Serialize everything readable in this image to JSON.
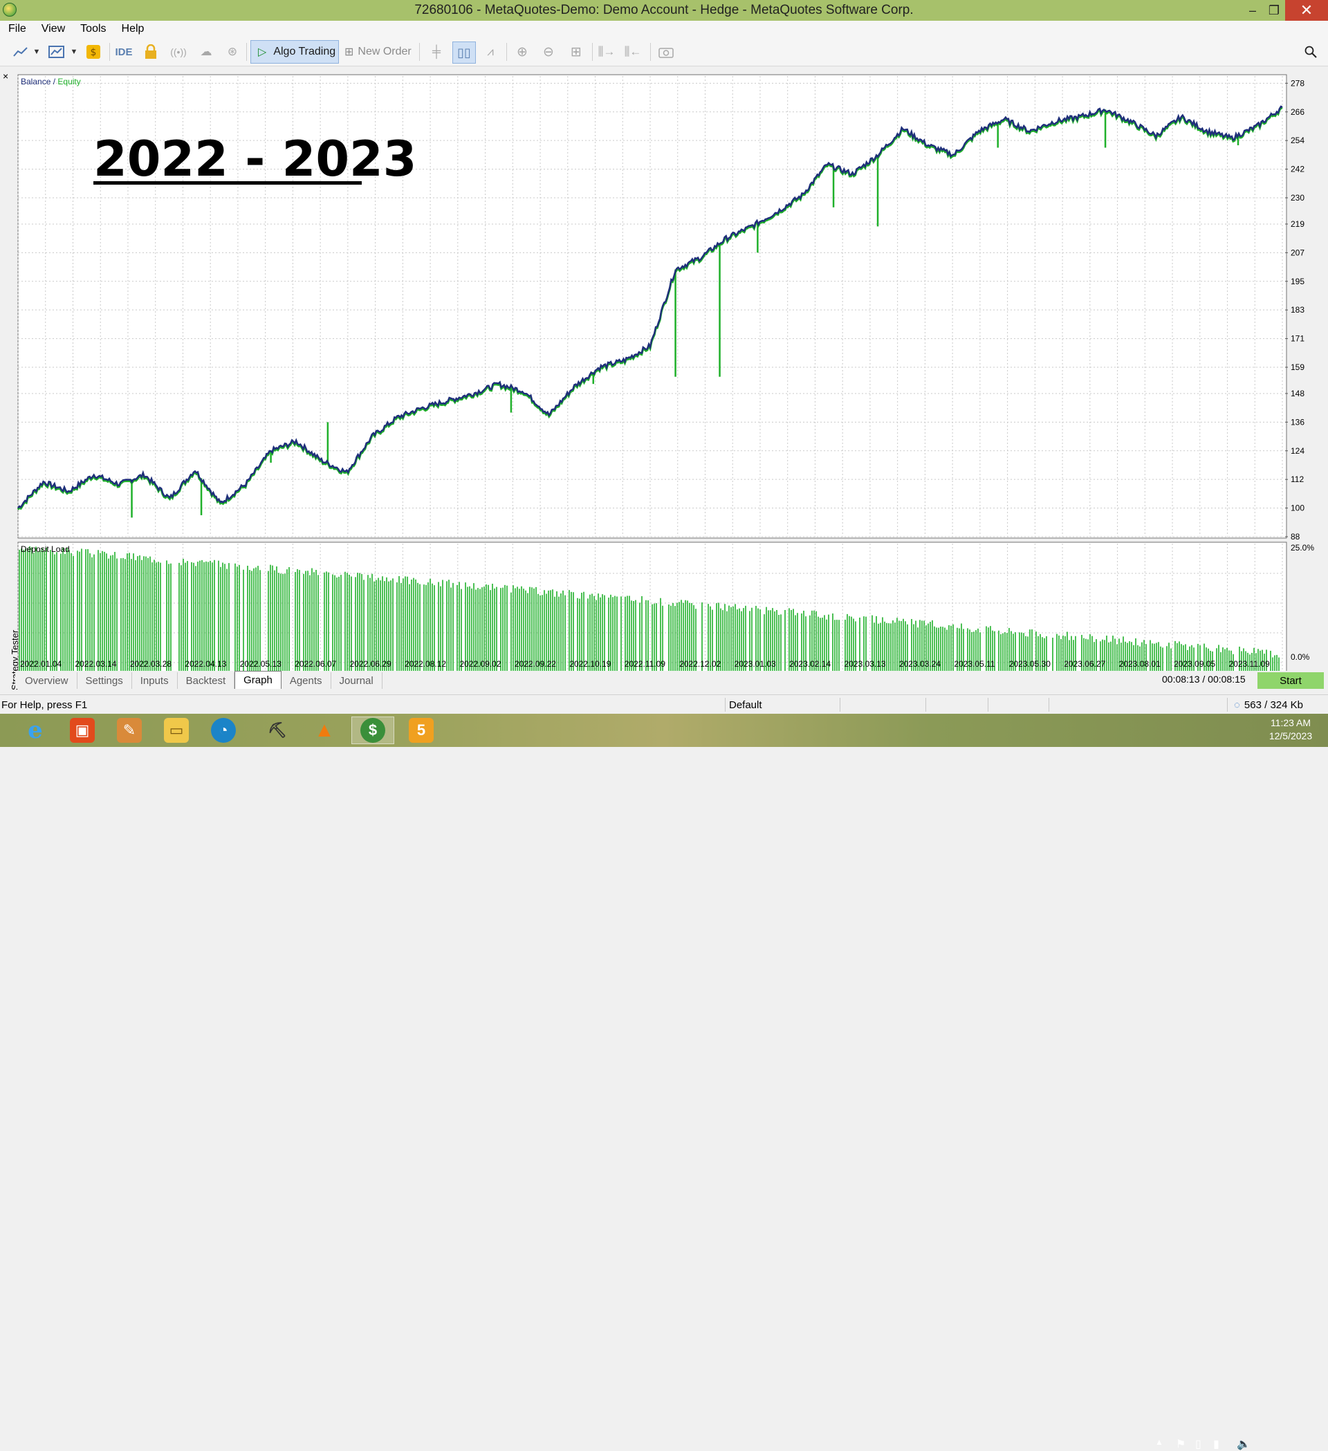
{
  "window": {
    "title": "72680106 - MetaQuotes-Demo: Demo Account - Hedge - MetaQuotes Software Corp.",
    "controls": {
      "minimize": "–",
      "maximize": "❐",
      "close": "✕"
    }
  },
  "menu": [
    "File",
    "View",
    "Tools",
    "Help"
  ],
  "toolbar": {
    "ide_label": "IDE",
    "algo_trading_label": "Algo Trading",
    "new_order_label": "New Order"
  },
  "chart": {
    "legend_balance": "Balance",
    "legend_separator": " / ",
    "legend_equity": "Equity",
    "overlay_title": "2022 - 2023",
    "subchart_label": "Deposit Load",
    "sub_y_top": "25.0%",
    "sub_y_bottom": "0.0%",
    "colors": {
      "balance": "#1f2f7a",
      "equity": "#1fb02a",
      "load": "#1fb02a",
      "grid": "#c9c9c9",
      "overlay": "#000000"
    }
  },
  "chart_data": {
    "type": "line",
    "y_ticks": [
      "278",
      "266",
      "254",
      "242",
      "230",
      "219",
      "207",
      "195",
      "183",
      "171",
      "159",
      "148",
      "136",
      "124",
      "112",
      "100",
      "88"
    ],
    "x_ticks": [
      "2022.01.04",
      "2022.03.14",
      "2022.03.28",
      "2022.04.13",
      "2022.05.13",
      "2022.06.07",
      "2022.06.29",
      "2022.08.12",
      "2022.09.02",
      "2022.09.22",
      "2022.10.19",
      "2022.11.09",
      "2022.12.02",
      "2023.01.03",
      "2023.02.14",
      "2023.03.13",
      "2023.03.24",
      "2023.05.11",
      "2023.05.30",
      "2023.06.27",
      "2023.08.01",
      "2023.09.05",
      "2023.11.09"
    ],
    "ylim": [
      88,
      281
    ],
    "series": [
      {
        "name": "Balance",
        "x": [
          0,
          0.02,
          0.04,
          0.06,
          0.08,
          0.1,
          0.12,
          0.14,
          0.16,
          0.18,
          0.2,
          0.22,
          0.24,
          0.26,
          0.28,
          0.3,
          0.32,
          0.34,
          0.36,
          0.38,
          0.4,
          0.42,
          0.44,
          0.46,
          0.48,
          0.5,
          0.52,
          0.54,
          0.56,
          0.58,
          0.6,
          0.62,
          0.64,
          0.66,
          0.68,
          0.7,
          0.72,
          0.74,
          0.76,
          0.78,
          0.8,
          0.82,
          0.84,
          0.86,
          0.88,
          0.9,
          0.92,
          0.94,
          0.96,
          0.98,
          1.0
        ],
        "y": [
          100,
          111,
          107,
          114,
          110,
          114,
          104,
          116,
          102,
          110,
          124,
          128,
          120,
          115,
          130,
          138,
          142,
          145,
          148,
          152,
          149,
          139,
          151,
          159,
          162,
          168,
          200,
          205,
          213,
          218,
          224,
          231,
          244,
          240,
          248,
          259,
          252,
          248,
          258,
          263,
          258,
          262,
          264,
          267,
          262,
          256,
          264,
          258,
          255,
          260,
          268
        ]
      },
      {
        "name": "Equity",
        "x": [
          0.09,
          0.145,
          0.2,
          0.245,
          0.315,
          0.39,
          0.455,
          0.52,
          0.555,
          0.585,
          0.645,
          0.68,
          0.735,
          0.775,
          0.86,
          0.965
        ],
        "y": [
          96,
          97,
          119,
          136,
          140,
          140,
          152,
          155,
          155,
          207,
          226,
          218,
          250,
          251,
          251,
          252
        ]
      }
    ],
    "deposit_load": {
      "ylim": [
        0,
        25
      ],
      "start": 24.5,
      "end": 9.5
    }
  },
  "tabs": [
    "Overview",
    "Settings",
    "Inputs",
    "Backtest",
    "Graph",
    "Agents",
    "Journal"
  ],
  "active_tab": "Graph",
  "side_label": "Strategy Tester",
  "side_close": "×",
  "timer": "00:08:13 / 00:08:15",
  "start_button": "Start",
  "status": {
    "help": "For Help, press F1",
    "profile": "Default",
    "traffic": "563 / 324 Kb"
  },
  "taskbar": {
    "time": "11:23 AM",
    "date": "12/5/2023",
    "apps": [
      "internet-explorer-icon",
      "office-icon",
      "paint-icon",
      "file-explorer-icon",
      "edge-icon",
      "pickaxe-icon",
      "vlc-icon",
      "metatrader-icon",
      "sublime-icon"
    ]
  }
}
